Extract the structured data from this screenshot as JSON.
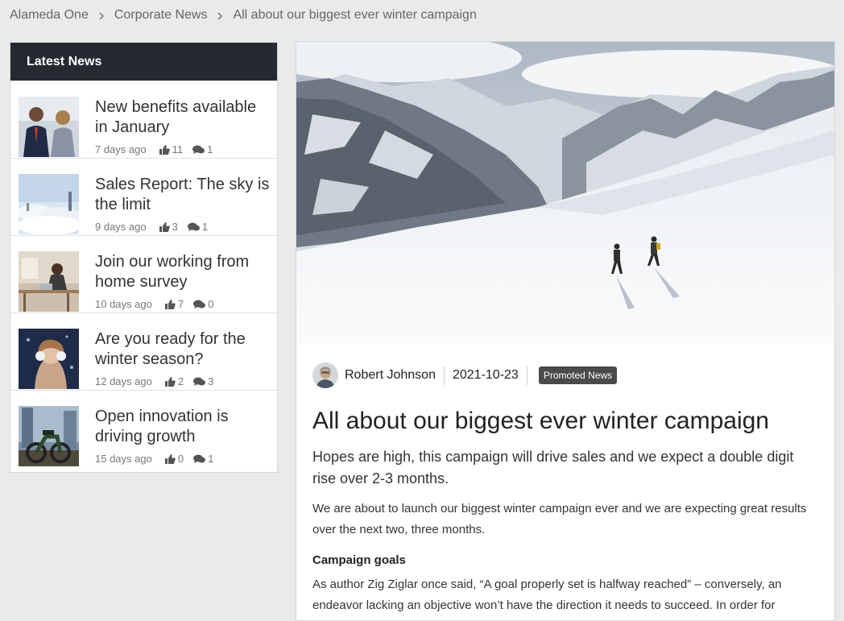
{
  "breadcrumb": {
    "items": [
      "Alameda One",
      "Corporate News",
      "All about our biggest ever winter campaign"
    ]
  },
  "sidebar": {
    "title": "Latest News",
    "items": [
      {
        "title": "New benefits available in January",
        "ago": "7 days ago",
        "likes": "11",
        "comments": "1"
      },
      {
        "title": "Sales Report: The sky is the limit",
        "ago": "9 days ago",
        "likes": "3",
        "comments": "1"
      },
      {
        "title": "Join our working from home survey",
        "ago": "10 days ago",
        "likes": "7",
        "comments": "0"
      },
      {
        "title": "Are you ready for the winter season?",
        "ago": "12 days ago",
        "likes": "2",
        "comments": "3"
      },
      {
        "title": "Open innovation is driving growth",
        "ago": "15 days ago",
        "likes": "0",
        "comments": "1"
      }
    ]
  },
  "article": {
    "author": "Robert Johnson",
    "date": "2021-10-23",
    "badge": "Promoted News",
    "title": "All about our biggest ever winter campaign",
    "lead": "Hopes are high, this campaign will drive sales and we expect a double digit rise over 2-3 months.",
    "paragraph1": "We are about to launch our biggest winter campaign ever and we are expecting great results over the next two, three months.",
    "subheading": "Campaign goals",
    "paragraph2": "As author Zig Ziglar once said, “A goal properly set is halfway reached” – conversely, an endeavor lacking an objective won’t have the direction it needs to succeed. In order for"
  },
  "icons": {
    "like": "thumbs-up-icon",
    "comment": "comments-icon",
    "separator": "chevron-right-icon"
  },
  "colors": {
    "header_bg": "#252a31",
    "page_bg": "#eaeaea",
    "badge_bg": "#4a4a4a"
  }
}
